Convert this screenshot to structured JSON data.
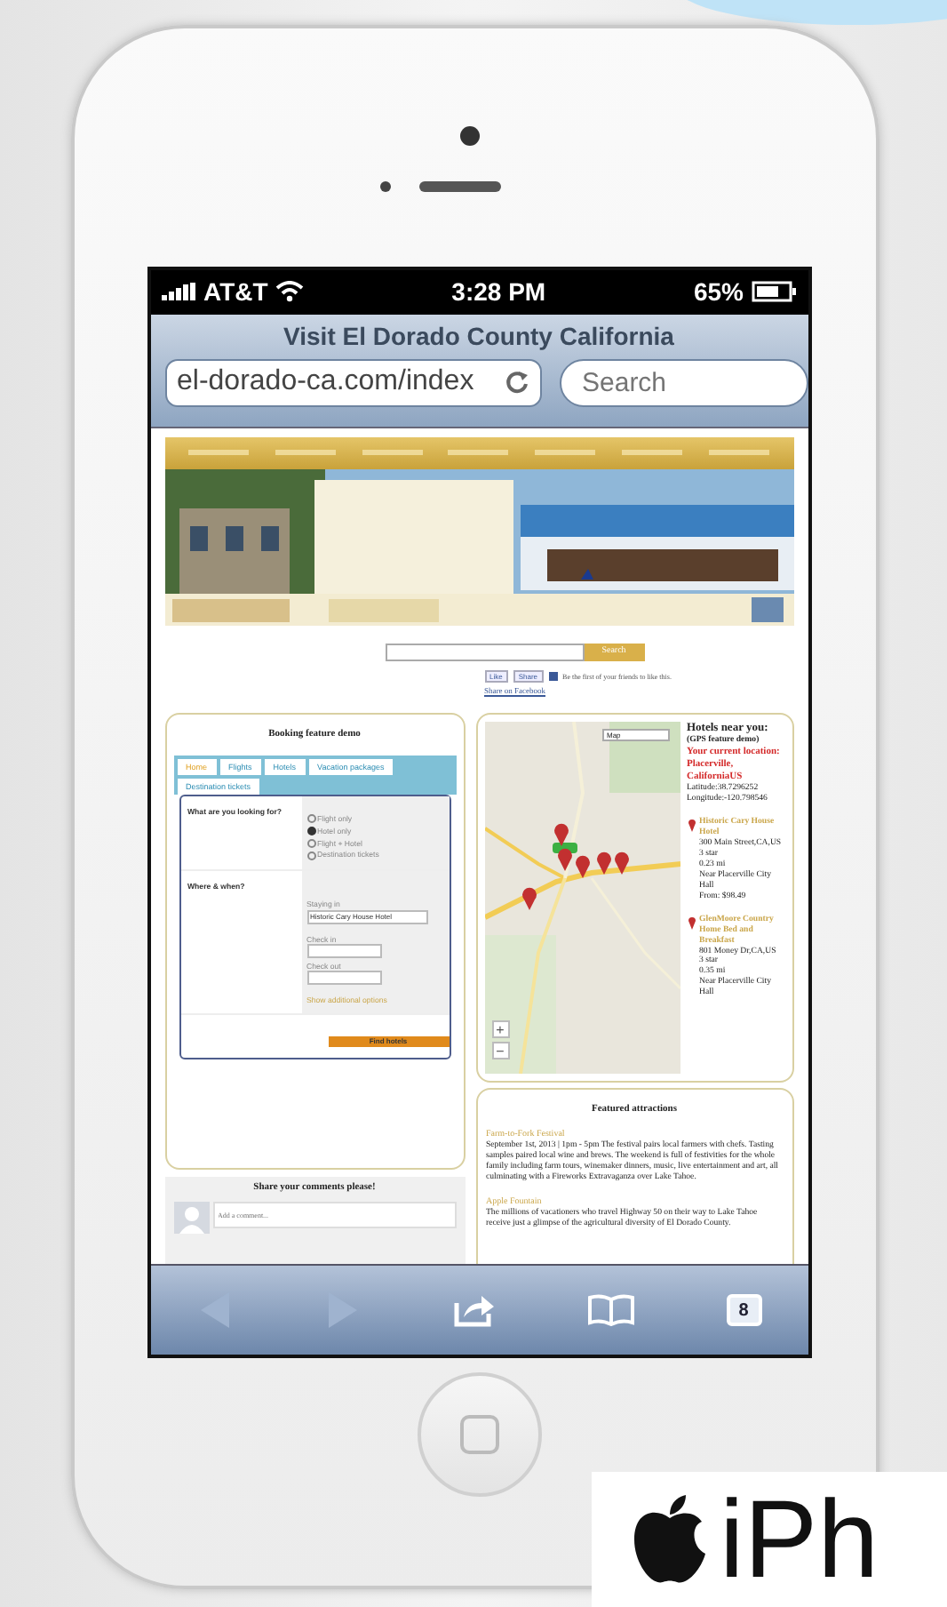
{
  "status_bar": {
    "carrier": "AT&T",
    "time": "3:28 PM",
    "battery": "65%"
  },
  "browser": {
    "title": "Visit El Dorado County California",
    "address": "el-dorado-ca.com/index",
    "search_placeholder": "Search"
  },
  "site_search": {
    "button": "Search"
  },
  "social": {
    "like": "Like",
    "share": "Share",
    "note": "Be the first of your friends to like this.",
    "link": "Share on Facebook"
  },
  "booking": {
    "title": "Booking feature demo",
    "tabs": [
      {
        "label": "Home",
        "selected": true
      },
      {
        "label": "Flights",
        "selected": false
      },
      {
        "label": "Hotels",
        "selected": false
      },
      {
        "label": "Vacation packages",
        "selected": false
      },
      {
        "label": "Destination tickets",
        "selected": false
      }
    ],
    "question": "What are you looking for?",
    "options": [
      {
        "label": "Flight only",
        "selected": false
      },
      {
        "label": "Hotel only",
        "selected": true
      },
      {
        "label": "Flight + Hotel",
        "selected": false
      },
      {
        "label": "Destination tickets",
        "selected": false
      }
    ],
    "where_label": "Where & when?",
    "staying_label": "Staying in",
    "staying_value": "Historic Cary House Hotel",
    "check_in_label": "Check in",
    "check_out_label": "Check out",
    "more_link": "Show additional options",
    "submit": "Find hotels"
  },
  "comments": {
    "title": "Share your comments please!",
    "placeholder": "Add a comment..."
  },
  "map": {
    "type_select": "Map",
    "zoom_in": "+",
    "zoom_out": "−"
  },
  "hotels": {
    "title": "Hotels near you:",
    "subtitle": "(GPS feature demo)",
    "location": "Your current location: Placerville, CaliforniaUS",
    "latitude": "Latitude:38.7296252",
    "longitude": "Longitude:-120.798546",
    "items": [
      {
        "name": "Historic Cary House Hotel",
        "lines": [
          "300 Main Street,CA,US",
          "3 star",
          "0.23 mi",
          "Near Placerville City Hall",
          "From: $98.49"
        ]
      },
      {
        "name": "GlenMoore Country Home Bed and Breakfast",
        "lines": [
          "801 Money Dr,CA,US",
          "3 star",
          "0.35 mi",
          "Near Placerville City Hall"
        ]
      }
    ]
  },
  "attractions": {
    "title": "Featured attractions",
    "items": [
      {
        "name": "Farm-to-Fork Festival",
        "text": "September 1st, 2013 | 1pm - 5pm The festival pairs local farmers with chefs. Tasting samples paired local wine and brews. The weekend is full of festivities for the whole family including farm tours, winemaker dinners, music, live entertainment and art, all culminating with a Fireworks Extravaganza over Lake Tahoe."
      },
      {
        "name": "Apple Fountain",
        "text": "The millions of vacationers who travel Highway 50 on their way to Lake Tahoe receive just a glimpse of the agricultural diversity of El Dorado County."
      }
    ]
  },
  "toolbar": {
    "back": {
      "disabled": true
    },
    "forward": {
      "disabled": true
    },
    "tabs_count": "8"
  },
  "device_label": "iPh"
}
